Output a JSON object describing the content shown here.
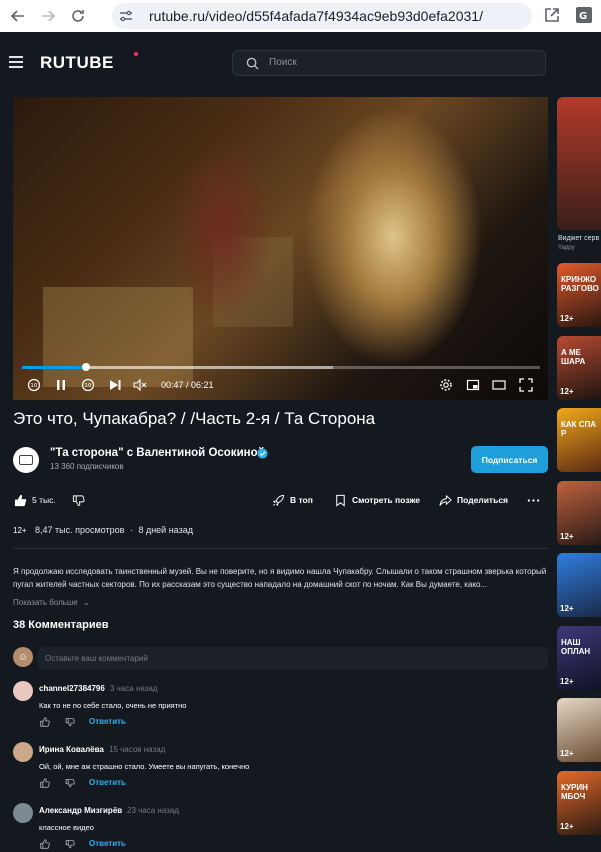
{
  "browser": {
    "url": "rutube.ru/video/d55f4afada7f4934ac9eb93d0efa2031/"
  },
  "header": {
    "logo": "RUTUBE",
    "search_placeholder": "Поиск"
  },
  "player": {
    "current_time": "00:47",
    "duration": "06:21",
    "time_display": "00:47 / 06:21",
    "progress_fraction": 0.123,
    "buffered_fraction": 0.6,
    "rewind_label": "10",
    "forward_label": "10"
  },
  "video": {
    "title": "Это что, Чупакабра? / /Часть 2-я / Та Сторона"
  },
  "channel": {
    "name": "\"Та сторона\" с Валентиной Осокиной",
    "subscribers": "13 360 подписчиков",
    "subscribe_label": "Подписаться"
  },
  "actions": {
    "likes": "5 тыс.",
    "top": "В топ",
    "watch_later": "Смотреть позже",
    "share": "Поделиться"
  },
  "meta": {
    "age": "12+",
    "views": "8,47 тыс. просмотров",
    "separator": "·",
    "ago": "8 дней назад"
  },
  "description": {
    "text": "Я продолжаю исследовать таинственный музей. Вы не поверите, но я видимо нашла Чупакабру. Слышали о таком страшном зверька который пугал жителей частных секторов. По их рассказам это существо нападало на домашний скот по ночам. Как Вы думаете, како...",
    "show_more": "Показать больше"
  },
  "comments": {
    "title": "38 Комментариев",
    "input_placeholder": "Оставьте ваш комментарий",
    "reply_label": "Ответить",
    "items": [
      {
        "author": "channel27384796",
        "time": "3 часа назад",
        "text": "Как то не по себе стало, очень не приятно",
        "avatar_color": "#e8c8c0"
      },
      {
        "author": "Ирина Ковалёва",
        "time": "15 часов назад",
        "text": "Ой, ой, мне аж страшно стало. Умеете вы напугать, конечно",
        "avatar_color": "#c9a98a"
      },
      {
        "author": "Александр Мизгирёв",
        "time": "23 часа назад",
        "text": "классное видео",
        "avatar_color": "#7d8a94"
      }
    ]
  },
  "rail": {
    "widget_text": "Виджет серв",
    "widget_sub": "Yappy",
    "items": [
      {
        "age": "12+",
        "caption": "КРИНЖО РАЗГОВО"
      },
      {
        "age": "12+",
        "caption": "А МЕ ШАРА"
      },
      {
        "age": "",
        "caption": "КАК СПА Р"
      },
      {
        "age": "12+",
        "caption": ""
      },
      {
        "age": "12+",
        "caption": ""
      },
      {
        "age": "12+",
        "caption": "НАШ ОПЛАН"
      },
      {
        "age": "12+",
        "caption": ""
      },
      {
        "age": "12+",
        "caption": "КУРИН МБОЧ"
      }
    ]
  }
}
